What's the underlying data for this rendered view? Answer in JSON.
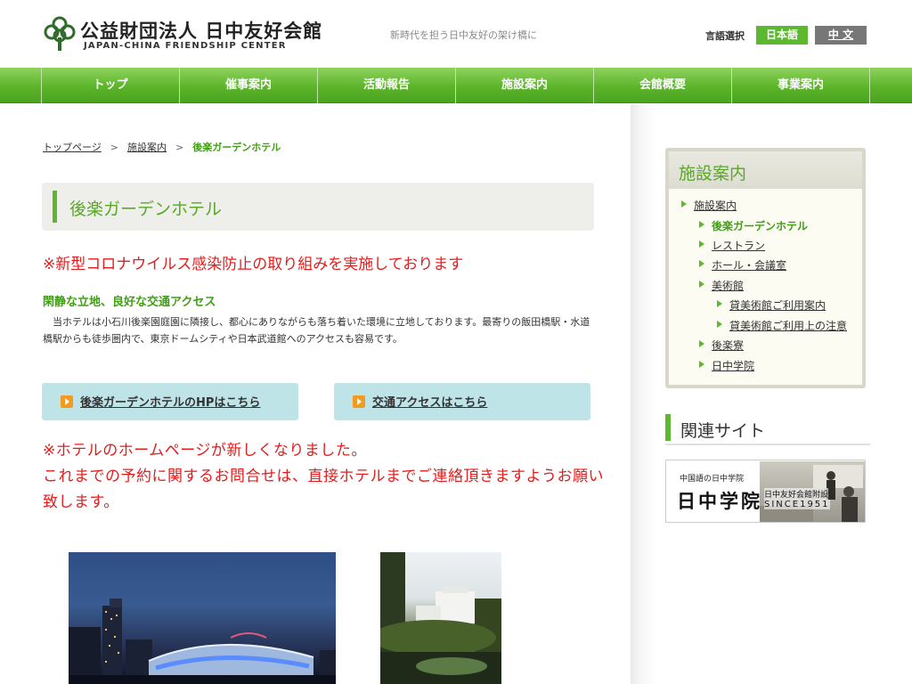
{
  "header": {
    "logo_title": "公益財団法人 日中友好会館",
    "logo_subtitle": "JAPAN-CHINA FRIENDSHIP CENTER",
    "tagline": "新時代を担う日中友好の架け橋に",
    "language_label": "言語選択",
    "lang_japanese": "日本語",
    "lang_chinese": "中 文",
    "accent_color": "#5cb830"
  },
  "nav": {
    "items": [
      "トップ",
      "催事案内",
      "活動報告",
      "施設案内",
      "会館概要",
      "事業案内"
    ]
  },
  "breadcrumb": {
    "items": [
      "トップページ",
      "施設案内",
      "後楽ガーデンホテル"
    ],
    "separator": ">"
  },
  "main": {
    "title": "後楽ガーデンホテル",
    "notice_covid": "※新型コロナウイルス感染防止の取り組みを実施しております",
    "subheading": "閑静な立地、良好な交通アクセス",
    "body": "　当ホテルは小石川後楽園庭園に隣接し、都心にありながらも落ち着いた環境に立地しております。最寄りの飯田橋駅・水道橋駅からも徒歩圏内で、東京ドームシティや日本武道館へのアクセスも容易です。",
    "link_hotel_hp": "後楽ガーデンホテルのHPはこちら",
    "link_access": "交通アクセスはこちら",
    "notice_hp_line1": "※ホテルのホームページが新しくなりました。",
    "notice_hp_line2": "これまでの予約に関するお問合せは、直接ホテルまでご連絡頂きますようお願い致します。"
  },
  "sidebar": {
    "menu_title": "施設案内",
    "menu_items": [
      {
        "label": "施設案内"
      },
      {
        "label": "後楽ガーデンホテル"
      },
      {
        "label": "レストラン"
      },
      {
        "label": "ホール・会議室"
      },
      {
        "label": "美術館"
      },
      {
        "label": "貸美術館ご利用案内"
      },
      {
        "label": "貸美術館ご利用上の注意"
      },
      {
        "label": "後楽寮"
      },
      {
        "label": "日中学院"
      }
    ],
    "related_title": "関連サイト",
    "banner": {
      "small_text": "中国語の日中学院",
      "big_text": "日中学院",
      "caption1": "日中友好会館附設",
      "caption2": "SINCE1951"
    }
  }
}
